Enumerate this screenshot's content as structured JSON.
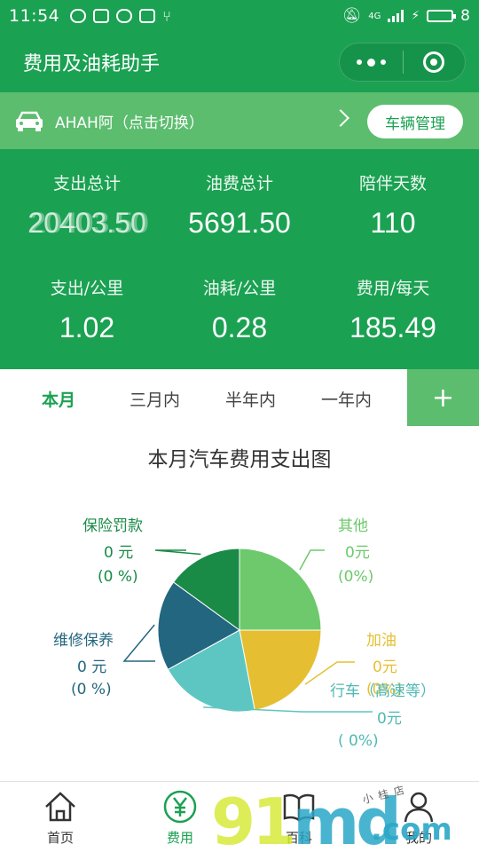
{
  "status_bar": {
    "time": "11:54",
    "network": "4G",
    "battery": "8"
  },
  "nav": {
    "title": "费用及油耗助手"
  },
  "vehicle": {
    "name": "AHAH阿（点击切换）",
    "manage_label": "车辆管理"
  },
  "stats": [
    {
      "label": "支出总计",
      "value": "20403.50"
    },
    {
      "label": "油费总计",
      "value": "5691.50"
    },
    {
      "label": "陪伴天数",
      "value": "110"
    },
    {
      "label": "支出/公里",
      "value": "1.02"
    },
    {
      "label": "油耗/公里",
      "value": "0.28"
    },
    {
      "label": "费用/每天",
      "value": "185.49"
    }
  ],
  "tabs": [
    "本月",
    "三月内",
    "半年内",
    "一年内"
  ],
  "add_label": "+",
  "chart_data": {
    "type": "pie",
    "title": "本月汽车费用支出图",
    "slices": [
      {
        "name": "其他",
        "amount": "0元",
        "percent": "(0%)",
        "value": 25,
        "color": "#6dc96b"
      },
      {
        "name": "加油",
        "amount": "0元",
        "percent": "(0%)",
        "value": 22,
        "color": "#e5bf31"
      },
      {
        "name": "行车（高速等）",
        "amount": "0元",
        "percent": "(    0%)",
        "value": 20,
        "color": "#5ec6c2"
      },
      {
        "name": "维修保养",
        "amount": "0    元",
        "percent": "(0 %)",
        "value": 18,
        "color": "#23667f"
      },
      {
        "name": "保险罚款",
        "amount": "0    元",
        "percent": "(0 %)",
        "value": 15,
        "color": "#1a8a47"
      }
    ]
  },
  "tabbar": [
    {
      "label": "首页",
      "icon": "home-icon"
    },
    {
      "label": "费用",
      "icon": "yen-icon"
    },
    {
      "label": "百科",
      "icon": "book-icon"
    },
    {
      "label": "我的",
      "icon": "user-icon"
    }
  ],
  "watermark": {
    "digits": "91",
    "letters": "md",
    "domain": ".com",
    "shop": "小桂店"
  }
}
